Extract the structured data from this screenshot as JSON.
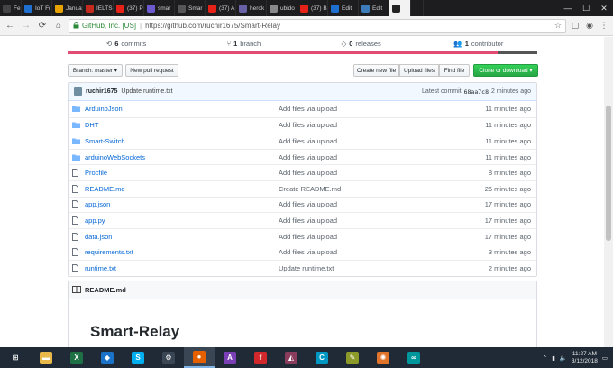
{
  "browser": {
    "tabs": [
      {
        "label": "Fe",
        "color": "#444"
      },
      {
        "label": "IoT Fr",
        "color": "#1e6fd0"
      },
      {
        "label": "Januar",
        "color": "#e8a200"
      },
      {
        "label": "IELTS",
        "color": "#c42b1c"
      },
      {
        "label": "(37) P",
        "color": "#e62117"
      },
      {
        "label": "smar",
        "color": "#6a5acd"
      },
      {
        "label": "Smar",
        "color": "#555"
      },
      {
        "label": "(37) A",
        "color": "#e62117"
      },
      {
        "label": "herok",
        "color": "#6762a6"
      },
      {
        "label": "ubido",
        "color": "#888"
      },
      {
        "label": "(37) B",
        "color": "#e62117"
      },
      {
        "label": "Edit",
        "color": "#1e6fd0"
      },
      {
        "label": "Edit",
        "color": "#3d7ab8"
      },
      {
        "label": "",
        "color": "#222"
      }
    ],
    "new_tab": "",
    "win_controls": {
      "minimize": "—",
      "maximize": "☐",
      "close": "✕"
    },
    "nav": {
      "back": "←",
      "forward": "→",
      "reload": "⟳",
      "home": "⌂"
    },
    "security_label": "GitHub, Inc. [US]",
    "url_separator": "|",
    "url": "https://github.com/ruchir1675/Smart-Relay",
    "icons": [
      "lock-icon",
      "bookmark-star-icon",
      "extension-icon",
      "menu-icon"
    ]
  },
  "repo": {
    "summary": {
      "commits_count": "6",
      "commits_label": "commits",
      "branch_count": "1",
      "branch_label": "branch",
      "releases_count": "0",
      "releases_label": "releases",
      "contributor_count": "1",
      "contributor_label": "contributor"
    },
    "lang_colors": {
      "primary": "#e34c72",
      "secondary": "#555555"
    },
    "buttons": {
      "branch": "Branch: master ▾",
      "pull_request": "New pull request",
      "create_file": "Create new file",
      "upload": "Upload files",
      "find": "Find file",
      "clone": "Clone or download ▾"
    },
    "latest_commit": {
      "author": "ruchir1675",
      "message": "Update runtime.txt",
      "label": "Latest commit",
      "sha": "68aa7c8",
      "age": "2 minutes ago"
    },
    "files": [
      {
        "type": "dir",
        "name": "ArduinoJson",
        "message": "Add files via upload",
        "age": "11 minutes ago"
      },
      {
        "type": "dir",
        "name": "DHT",
        "message": "Add files via upload",
        "age": "11 minutes ago"
      },
      {
        "type": "dir",
        "name": "Smart-Switch",
        "message": "Add files via upload",
        "age": "11 minutes ago"
      },
      {
        "type": "dir",
        "name": "arduinoWebSockets",
        "message": "Add files via upload",
        "age": "11 minutes ago"
      },
      {
        "type": "file",
        "name": "Procfile",
        "message": "Add files via upload",
        "age": "8 minutes ago"
      },
      {
        "type": "file",
        "name": "README.md",
        "message": "Create README.md",
        "age": "26 minutes ago"
      },
      {
        "type": "file",
        "name": "app.json",
        "message": "Add files via upload",
        "age": "17 minutes ago"
      },
      {
        "type": "file",
        "name": "app.py",
        "message": "Add files via upload",
        "age": "17 minutes ago"
      },
      {
        "type": "file",
        "name": "data.json",
        "message": "Add files via upload",
        "age": "17 minutes ago"
      },
      {
        "type": "file",
        "name": "requirements.txt",
        "message": "Add files via upload",
        "age": "3 minutes ago"
      },
      {
        "type": "file",
        "name": "runtime.txt",
        "message": "Update runtime.txt",
        "age": "2 minutes ago"
      }
    ],
    "readme": {
      "header": "README.md",
      "title": "Smart-Relay"
    }
  },
  "taskbar": {
    "apps": [
      {
        "name": "start",
        "glyph": "⊞",
        "color": "#1f2a36"
      },
      {
        "name": "file-explorer",
        "glyph": "▬",
        "color": "#e8b84a"
      },
      {
        "name": "excel",
        "glyph": "X",
        "color": "#1e7145"
      },
      {
        "name": "defender",
        "glyph": "◆",
        "color": "#1a73c8"
      },
      {
        "name": "skype",
        "glyph": "S",
        "color": "#00aff0"
      },
      {
        "name": "settings",
        "glyph": "⚙",
        "color": "#3a4654"
      },
      {
        "name": "firefox",
        "glyph": "●",
        "color": "#e66000"
      },
      {
        "name": "app-purple",
        "glyph": "A",
        "color": "#7b3fb5"
      },
      {
        "name": "foxit",
        "glyph": "f",
        "color": "#d3282b"
      },
      {
        "name": "app-prism",
        "glyph": "◭",
        "color": "#8a3c5c"
      },
      {
        "name": "app-c",
        "glyph": "C",
        "color": "#0098c3"
      },
      {
        "name": "app-pen",
        "glyph": "✎",
        "color": "#8c9a2a"
      },
      {
        "name": "app-rays",
        "glyph": "✺",
        "color": "#e0742a"
      },
      {
        "name": "arduino",
        "glyph": "∞",
        "color": "#00979c"
      }
    ],
    "time": "11:27 AM",
    "date": "3/12/2018"
  }
}
